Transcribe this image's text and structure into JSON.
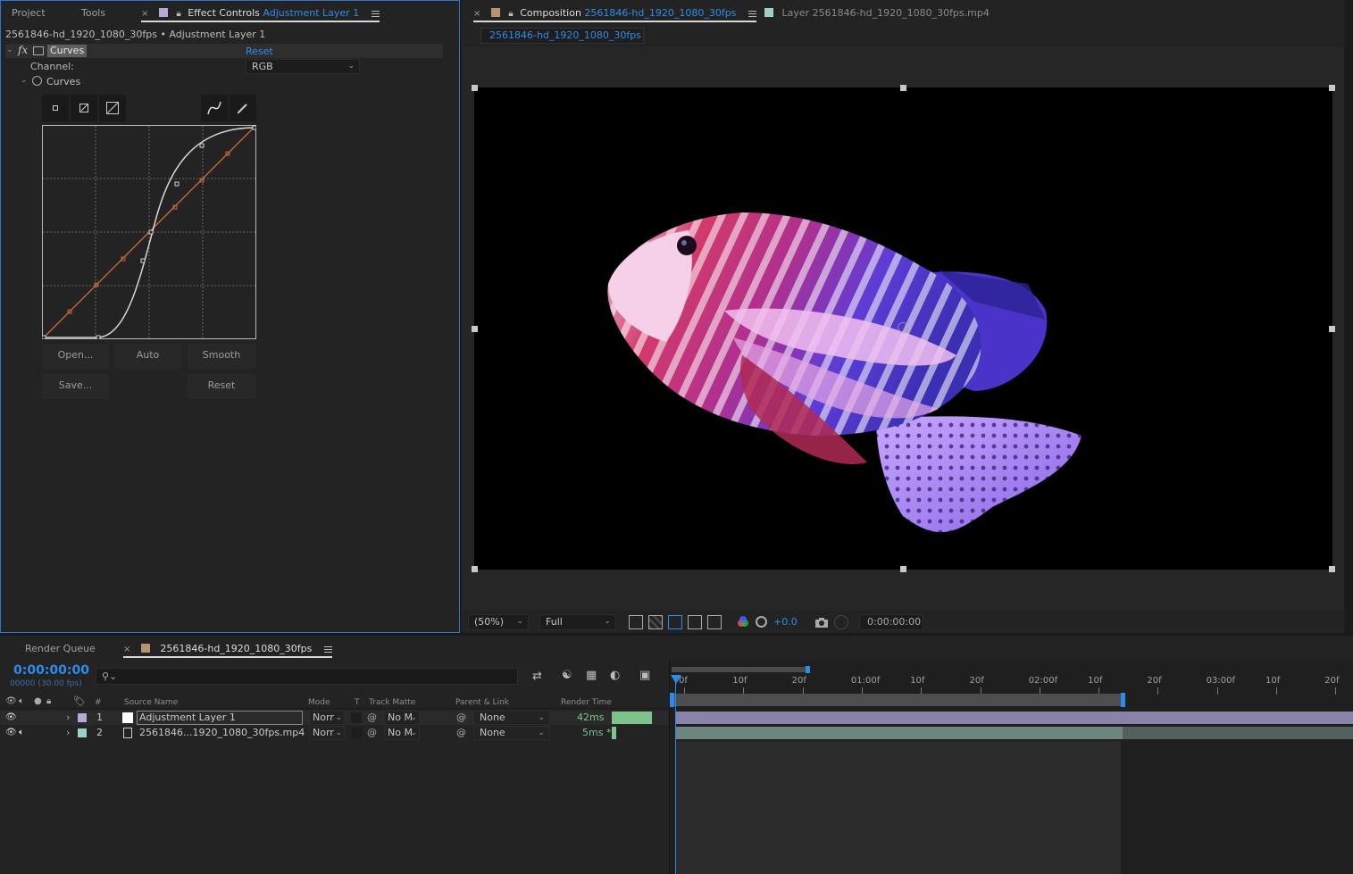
{
  "left_panel": {
    "tabs": {
      "project": "Project",
      "tools": "Tools",
      "effect_controls": "Effect Controls",
      "effect_controls_layer": "Adjustment Layer 1"
    },
    "breadcrumb": "2561846-hd_1920_1080_30fps • Adjustment Layer 1",
    "effect": {
      "fx": "fx",
      "name": "Curves",
      "reset": "Reset",
      "channel_label": "Channel:",
      "channel_value": "RGB",
      "curves_label": "Curves"
    },
    "buttons": {
      "open": "Open...",
      "auto": "Auto",
      "smooth": "Smooth",
      "save": "Save...",
      "reset": "Reset"
    }
  },
  "comp_panel": {
    "tab_prefix": "Composition",
    "tab_comp_name": "2561846-hd_1920_1080_30fps",
    "layer_tab": "Layer  2561846-hd_1920_1080_30fps.mp4",
    "subtab": "2561846-hd_1920_1080_30fps",
    "zoom": "(50%)",
    "resolution": "Full",
    "exposure": "+0.0",
    "timecode": "0:00:00:00"
  },
  "bottom_tabs": {
    "render_queue": "Render Queue",
    "timeline": "2561846-hd_1920_1080_30fps"
  },
  "timeline": {
    "current_time": "0:00:00:00",
    "frame_info": "00000 (30.00 fps)",
    "search_placeholder": "",
    "headers": {
      "num": "#",
      "source_name": "Source Name",
      "mode": "Mode",
      "t": "T",
      "track_matte": "Track Matte",
      "parent": "Parent & Link",
      "render_time": "Render Time"
    },
    "layers": [
      {
        "num": "1",
        "name": "Adjustment Layer 1",
        "mode": "Norr",
        "matte": "No M",
        "parent": "None",
        "render_time": "42ms",
        "label_color": "#b6a9d6",
        "render_fraction": 1.0
      },
      {
        "num": "2",
        "name": "2561846...1920_1080_30fps.mp4",
        "mode": "Norr",
        "matte": "No M",
        "parent": "None",
        "render_time": "5ms *",
        "label_color": "#9fd0c8",
        "render_fraction": 0.12
      }
    ],
    "ruler": [
      "0f",
      "10f",
      "20f",
      "01:00f",
      "10f",
      "20f",
      "02:00f",
      "10f",
      "20f",
      "03:00f",
      "10f",
      "20f"
    ]
  },
  "colors": {
    "accent_blue": "#2d8ceb",
    "curve_rgb": "#d8d8d8",
    "curve_diag": "#c0653a",
    "layer1_bar": "#8a83a9",
    "layer2_bar": "#6f857f",
    "render_bar": "#7cc48c"
  }
}
